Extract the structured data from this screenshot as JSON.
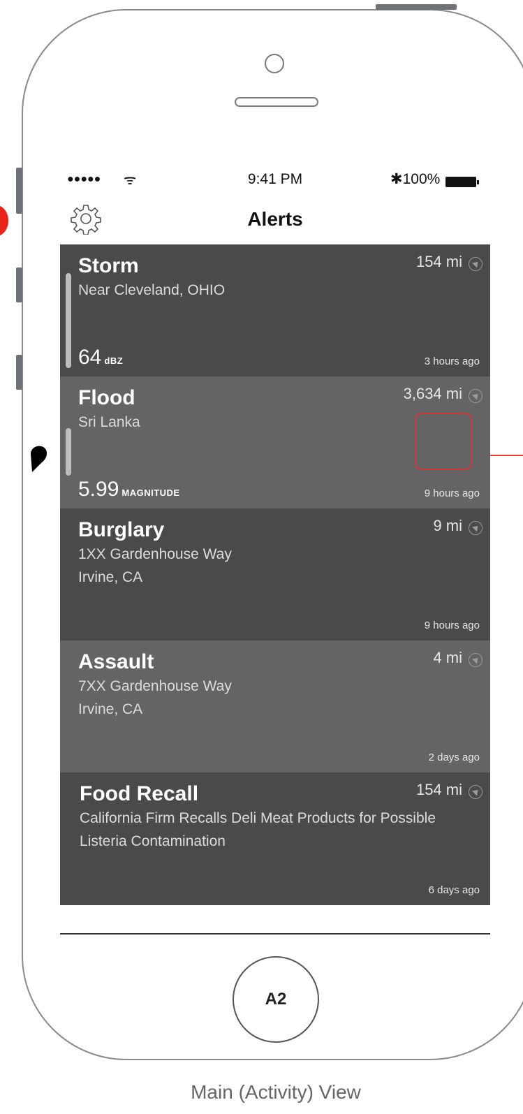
{
  "device": {
    "home_button_label": "A2",
    "caption": "Main (Activity) View"
  },
  "status_bar": {
    "signal": "●●●●●",
    "wifi": "ᯤ",
    "time": "9:41 PM",
    "battery": "✱100%"
  },
  "nav": {
    "title": "Alerts"
  },
  "alerts": [
    {
      "title": "Storm",
      "subtitle": "Near Cleveland, OHIO",
      "distance": "154 mi",
      "value": "64",
      "unit": "dBZ",
      "time": "3 hours ago"
    },
    {
      "title": "Flood",
      "subtitle": "Sri Lanka",
      "distance": "3,634 mi",
      "value": "5.99",
      "unit": "MAGNITUDE",
      "time": "9 hours ago"
    },
    {
      "title": "Burglary",
      "subtitle": "1XX Gardenhouse Way\nIrvine, CA",
      "distance": "9 mi",
      "time": "9 hours ago"
    },
    {
      "title": "Assault",
      "subtitle": "7XX Gardenhouse Way\nIrvine, CA",
      "distance": "4 mi",
      "time": "2 days ago"
    },
    {
      "title": "Food Recall",
      "subtitle": "California Firm Recalls Deli Meat Products for Possible Listeria Contamination",
      "distance": "154 mi",
      "time": "6 days ago"
    }
  ]
}
